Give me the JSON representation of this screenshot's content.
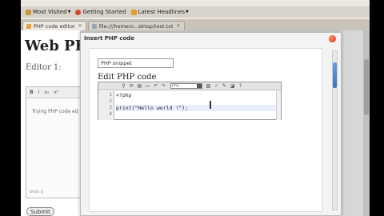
{
  "bookmarks": [
    {
      "label": "Most Visited",
      "has_menu": true,
      "icon_color": "#c99a3c"
    },
    {
      "label": "Getting Started",
      "has_menu": false,
      "icon_color": "#d24a2a"
    },
    {
      "label": "Latest Headlines",
      "has_menu": true,
      "icon_color": "#e59a2b"
    }
  ],
  "tabs": [
    {
      "label": "PHP code editor",
      "active": true
    },
    {
      "label": "file:///home/o...sktop/test.txt",
      "active": false
    }
  ],
  "page": {
    "title": "Web PHP",
    "editor_label": "Editor 1:",
    "bg_toolbar": [
      "B",
      "I",
      "x₂",
      "x²"
    ],
    "bg_text": "Trying PHP code ed",
    "bg_path": "body p",
    "submit_label": "Submit"
  },
  "dialog": {
    "title": "Insert PHP code",
    "snippet_value": "PHP snippet",
    "heading": "Edit PHP code",
    "toolbar_select_value": "php",
    "line_numbers": [
      "1",
      "2",
      "3",
      "4"
    ],
    "code_lines": [
      "<?php",
      "",
      "print(\"Hello world !\");",
      ""
    ]
  },
  "colors": {
    "close_button": "#e2461f",
    "scroll_thumb": "#4a7fcc",
    "active_line": "#e8eefc"
  }
}
